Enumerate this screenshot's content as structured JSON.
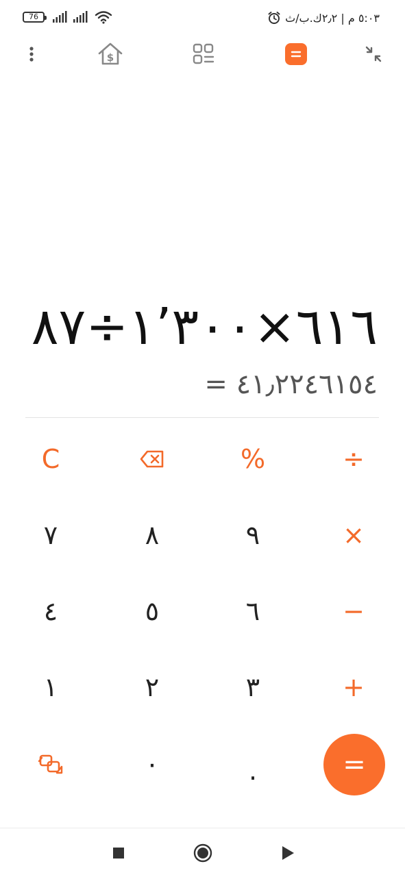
{
  "status_bar": {
    "battery": "76",
    "right_text": "٥:٠٣ م | ٢٫٢ك.ب/ث"
  },
  "toolbar": {
    "icons": [
      "more-vert-icon",
      "currency-converter-icon",
      "grid-list-icon",
      "calculator-icon",
      "collapse-icon"
    ]
  },
  "display": {
    "expression": "٦١٦×١٬٣٠٠÷٨٧",
    "result": "= ٤١٫٢٢٤٦١٥٤"
  },
  "keypad": {
    "row1": [
      "C",
      "backspace-icon",
      "%",
      "÷"
    ],
    "row2": [
      "٧",
      "٨",
      "٩",
      "×"
    ],
    "row3": [
      "٤",
      "٥",
      "٦",
      "−"
    ],
    "row4": [
      "١",
      "٢",
      "٣",
      "+"
    ],
    "row5": [
      "swap-icon",
      "٠",
      ".",
      "="
    ]
  },
  "labels": {
    "clear": "C",
    "percent": "%",
    "divide": "÷",
    "multiply": "×",
    "minus": "−",
    "plus": "+",
    "equals": "=",
    "seven": "٧",
    "eight": "٨",
    "nine": "٩",
    "four": "٤",
    "five": "٥",
    "six": "٦",
    "one": "١",
    "two": "٢",
    "three": "٣",
    "zero": "٠",
    "dot": "."
  },
  "colors": {
    "accent": "#f36a2a",
    "equals_bg": "#fa6e2c"
  }
}
